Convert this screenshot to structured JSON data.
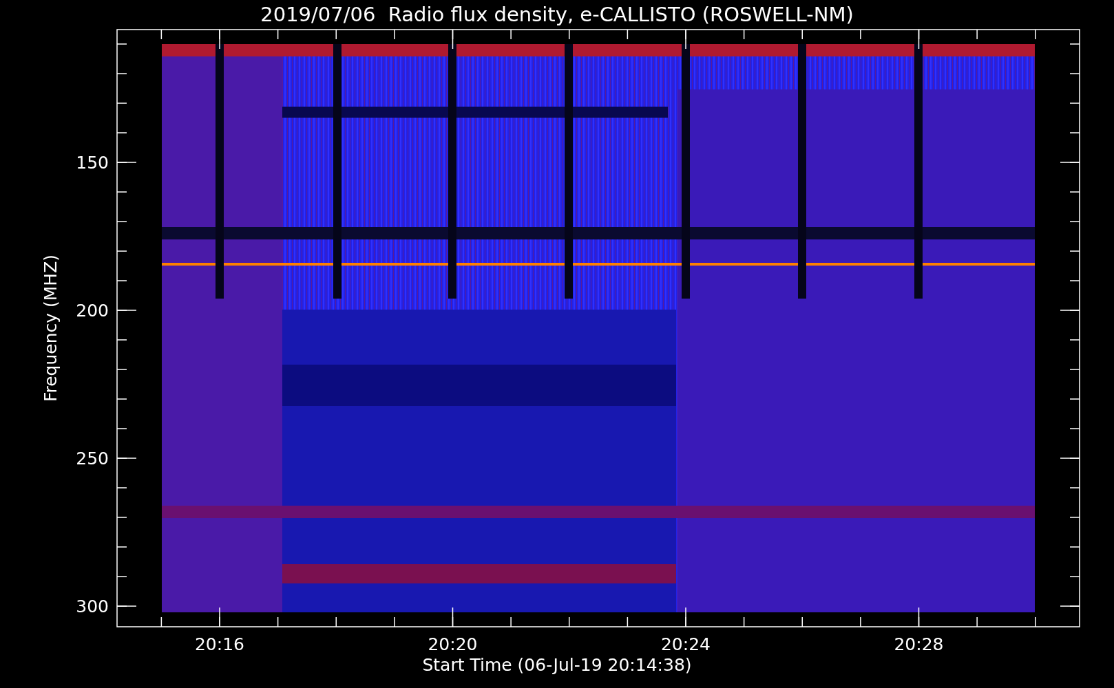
{
  "title": "2019/07/06  Radio flux density, e-CALLISTO (ROSWELL-NM)",
  "x_axis": {
    "label": "Start Time (06-Jul-19 20:14:38)",
    "ticks": [
      "20:16",
      "20:20",
      "20:24",
      "20:28"
    ]
  },
  "y_axis": {
    "label": "Frequency (MHZ)",
    "ticks": [
      "150",
      "200",
      "250",
      "300"
    ]
  }
}
